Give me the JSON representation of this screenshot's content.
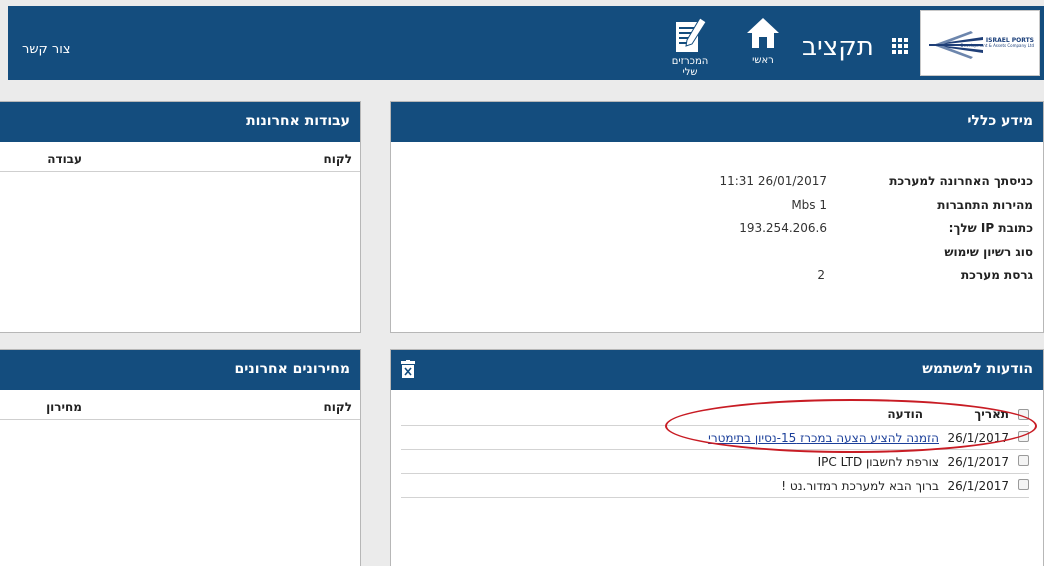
{
  "header": {
    "app_title": "תקציב",
    "contact_label": "צור קשר",
    "nav": {
      "home_label": "ראשי",
      "tenders_line1": "המכרזים",
      "tenders_line2": "שלי"
    },
    "logo": {
      "name": "ISRAEL PORTS",
      "subtitle": "Development & Assets Company Ltd"
    },
    "colors": {
      "bar": "#144d7e"
    }
  },
  "general_info": {
    "title": "מידע כללי",
    "rows": [
      {
        "label": "כניסתך האחרונה למערכת",
        "value": "11:31 26/01/2017"
      },
      {
        "label": "מהירות התחברות",
        "value": "Mbs 1"
      },
      {
        "label": "כתובת IP שלך:",
        "value": "193.254.206.6"
      },
      {
        "label": "סוג רשיון שימוש",
        "value": ""
      },
      {
        "label": "גרסת מערכת",
        "value": "2"
      }
    ]
  },
  "recent_jobs": {
    "title": "עבודות אחרונות",
    "columns": {
      "client": "לקוח",
      "job": "עבודה"
    }
  },
  "user_messages": {
    "title": "הודעות למשתמש",
    "trash_icon": "trash-icon",
    "columns": {
      "date": "תאריך",
      "message": "הודעה"
    },
    "rows": [
      {
        "date": "26/1/2017",
        "text": "הזמנה להציע הצעה במכרז 15-נסיון בתימטרי",
        "link": true
      },
      {
        "date": "26/1/2017",
        "text": "צורפת לחשבון IPC LTD",
        "link": false
      },
      {
        "date": "26/1/2017",
        "text": "ברוך הבא למערכת רמדור.נט !",
        "link": false
      }
    ],
    "highlight_color": "#c81c24"
  },
  "recent_quotes": {
    "title": "מחירונים אחרונים",
    "columns": {
      "client": "לקוח",
      "pricelist": "מחירון"
    }
  }
}
